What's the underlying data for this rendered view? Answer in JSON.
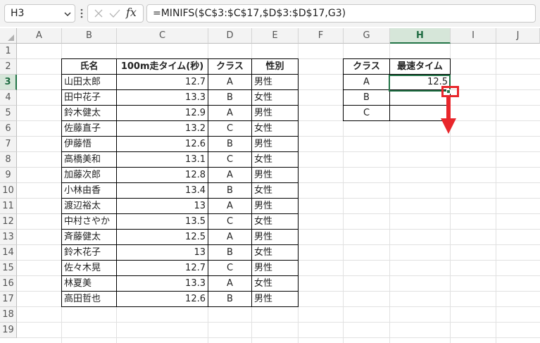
{
  "name_box": {
    "value": "H3"
  },
  "formula_bar": {
    "formula": "=MINIFS($C$3:$C$17,$D$3:$D$17,G3)",
    "function_glyph": "fx"
  },
  "columns": [
    "A",
    "B",
    "C",
    "D",
    "E",
    "F",
    "G",
    "H",
    "I",
    "J"
  ],
  "rows": [
    "1",
    "2",
    "3",
    "4",
    "5",
    "6",
    "7",
    "8",
    "9",
    "10",
    "11",
    "12",
    "13",
    "14",
    "15",
    "16",
    "17",
    "18",
    "19"
  ],
  "selected": {
    "column": "H",
    "row": "3"
  },
  "main_table": {
    "headers": [
      "氏名",
      "100m走タイム(秒)",
      "クラス",
      "性別"
    ],
    "rows": [
      [
        "山田太郎",
        "12.7",
        "A",
        "男性"
      ],
      [
        "田中花子",
        "13.3",
        "B",
        "女性"
      ],
      [
        "鈴木健太",
        "12.9",
        "A",
        "男性"
      ],
      [
        "佐藤直子",
        "13.2",
        "C",
        "女性"
      ],
      [
        "伊藤悟",
        "12.6",
        "B",
        "男性"
      ],
      [
        "高橋美和",
        "13.1",
        "C",
        "女性"
      ],
      [
        "加藤次郎",
        "12.8",
        "A",
        "男性"
      ],
      [
        "小林由香",
        "13.4",
        "B",
        "女性"
      ],
      [
        "渡辺裕太",
        "13",
        "A",
        "男性"
      ],
      [
        "中村さやか",
        "13.5",
        "C",
        "女性"
      ],
      [
        "斉藤健太",
        "12.5",
        "A",
        "男性"
      ],
      [
        "鈴木花子",
        "13",
        "B",
        "女性"
      ],
      [
        "佐々木晃",
        "12.7",
        "C",
        "男性"
      ],
      [
        "林夏美",
        "13.3",
        "A",
        "女性"
      ],
      [
        "高田哲也",
        "12.6",
        "B",
        "男性"
      ]
    ]
  },
  "summary_table": {
    "headers": [
      "クラス",
      "最速タイム"
    ],
    "rows": [
      [
        "A",
        "12.5"
      ],
      [
        "B",
        ""
      ],
      [
        "C",
        ""
      ]
    ]
  },
  "colors": {
    "selection": "#217346",
    "callout": "#e8262b",
    "header_bg": "#f3f3f3"
  },
  "icons": {
    "name_box_dropdown": "chevron-down-icon",
    "formula_more": "vertical-dots-icon",
    "cancel": "cancel-x-icon",
    "enter": "check-icon",
    "insert_function": "fx-icon",
    "select_all": "select-all-triangle-icon",
    "fill_handle_marker": "highlight-box-icon",
    "drag_direction": "down-arrow-icon"
  }
}
